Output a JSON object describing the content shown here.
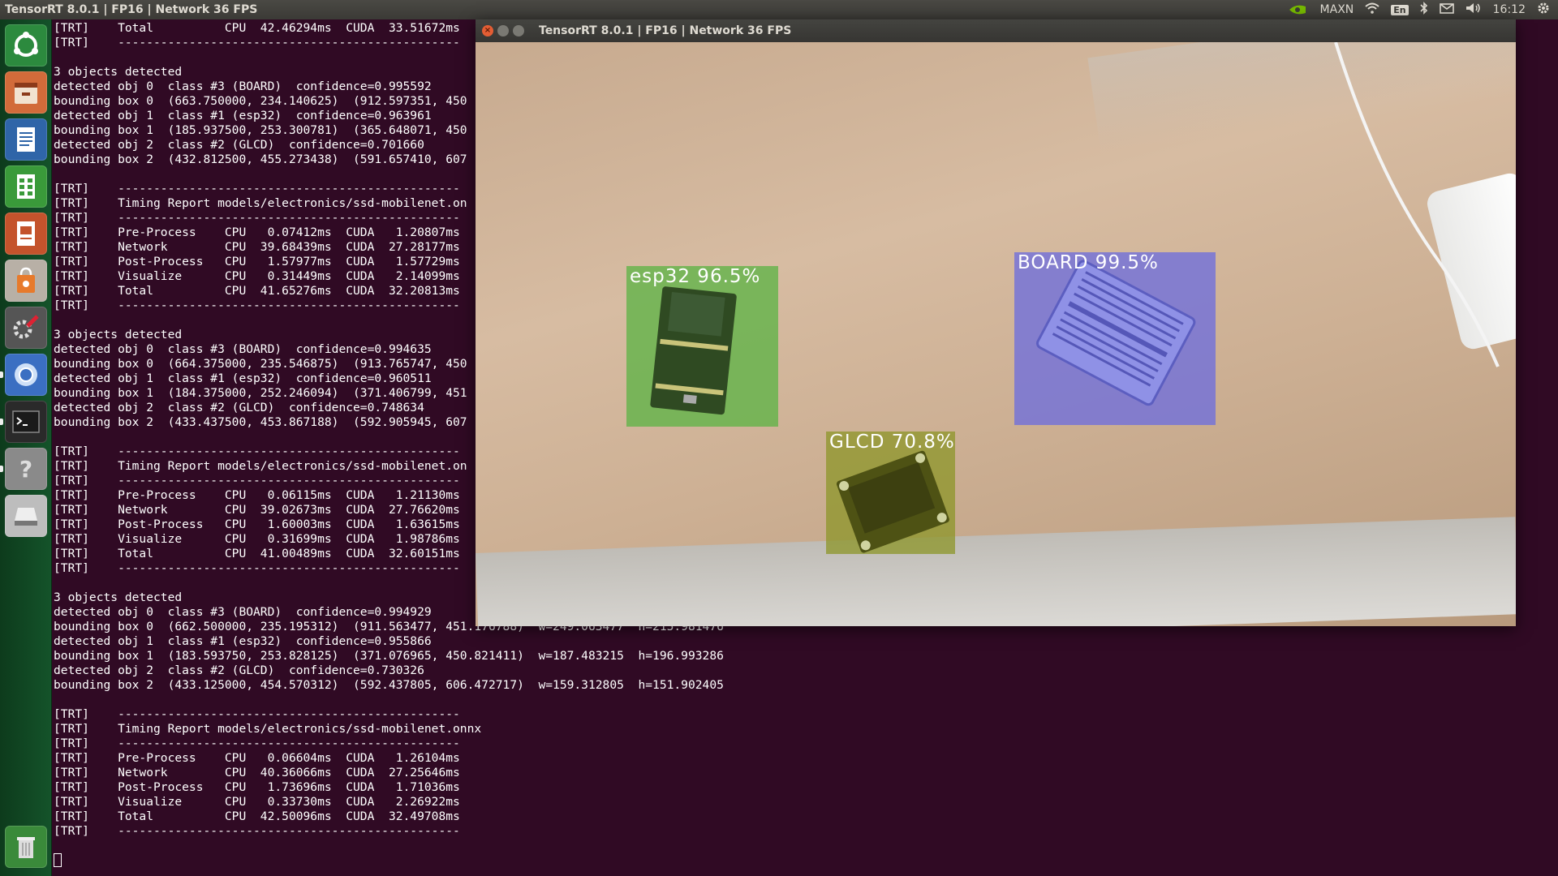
{
  "top_panel": {
    "title": "TensorRT 8.0.1 | FP16 | Network 36 FPS",
    "power_mode": "MAXN",
    "keyboard": "En",
    "clock": "16:12"
  },
  "launcher": {
    "items": [
      "ubuntu-logo-icon",
      "files-icon",
      "writer-icon",
      "calc-icon",
      "impress-icon",
      "software-center-icon",
      "settings-icon",
      "chromium-icon",
      "terminal-icon",
      "help-icon",
      "drive-icon",
      "trash-icon"
    ]
  },
  "terminal": {
    "lines": [
      "[TRT]    Total          CPU  42.46294ms  CUDA  33.51672ms",
      "[TRT]    ------------------------------------------------",
      "",
      "3 objects detected",
      "detected obj 0  class #3 (BOARD)  confidence=0.995592",
      "bounding box 0  (663.750000, 234.140625)  (912.597351, 450",
      "detected obj 1  class #1 (esp32)  confidence=0.963961",
      "bounding box 1  (185.937500, 253.300781)  (365.648071, 450",
      "detected obj 2  class #2 (GLCD)  confidence=0.701660",
      "bounding box 2  (432.812500, 455.273438)  (591.657410, 607",
      "",
      "[TRT]    ------------------------------------------------",
      "[TRT]    Timing Report models/electronics/ssd-mobilenet.on",
      "[TRT]    ------------------------------------------------",
      "[TRT]    Pre-Process    CPU   0.07412ms  CUDA   1.20807ms",
      "[TRT]    Network        CPU  39.68439ms  CUDA  27.28177ms",
      "[TRT]    Post-Process   CPU   1.57977ms  CUDA   1.57729ms",
      "[TRT]    Visualize      CPU   0.31449ms  CUDA   2.14099ms",
      "[TRT]    Total          CPU  41.65276ms  CUDA  32.20813ms",
      "[TRT]    ------------------------------------------------",
      "",
      "3 objects detected",
      "detected obj 0  class #3 (BOARD)  confidence=0.994635",
      "bounding box 0  (664.375000, 235.546875)  (913.765747, 450",
      "detected obj 1  class #1 (esp32)  confidence=0.960511",
      "bounding box 1  (184.375000, 252.246094)  (371.406799, 451",
      "detected obj 2  class #2 (GLCD)  confidence=0.748634",
      "bounding box 2  (433.437500, 453.867188)  (592.905945, 607",
      "",
      "[TRT]    ------------------------------------------------",
      "[TRT]    Timing Report models/electronics/ssd-mobilenet.on",
      "[TRT]    ------------------------------------------------",
      "[TRT]    Pre-Process    CPU   0.06115ms  CUDA   1.21130ms",
      "[TRT]    Network        CPU  39.02673ms  CUDA  27.76620ms",
      "[TRT]    Post-Process   CPU   1.60003ms  CUDA   1.63615ms",
      "[TRT]    Visualize      CPU   0.31699ms  CUDA   1.98786ms",
      "[TRT]    Total          CPU  41.00489ms  CUDA  32.60151ms",
      "[TRT]    ------------------------------------------------",
      "",
      "3 objects detected",
      "detected obj 0  class #3 (BOARD)  confidence=0.994929",
      "bounding box 0  (662.500000, 235.195312)  (911.563477, 451.176788)  w=249.063477  h=215.981476",
      "detected obj 1  class #1 (esp32)  confidence=0.955866",
      "bounding box 1  (183.593750, 253.828125)  (371.076965, 450.821411)  w=187.483215  h=196.993286",
      "detected obj 2  class #2 (GLCD)  confidence=0.730326",
      "bounding box 2  (433.125000, 454.570312)  (592.437805, 606.472717)  w=159.312805  h=151.902405",
      "",
      "[TRT]    ------------------------------------------------",
      "[TRT]    Timing Report models/electronics/ssd-mobilenet.onnx",
      "[TRT]    ------------------------------------------------",
      "[TRT]    Pre-Process    CPU   0.06604ms  CUDA   1.26104ms",
      "[TRT]    Network        CPU  40.36066ms  CUDA  27.25646ms",
      "[TRT]    Post-Process   CPU   1.73696ms  CUDA   1.71036ms",
      "[TRT]    Visualize      CPU   0.33730ms  CUDA   2.26922ms",
      "[TRT]    Total          CPU  42.50096ms  CUDA  32.49708ms",
      "[TRT]    ------------------------------------------------"
    ]
  },
  "camera_window": {
    "title": "TensorRT 8.0.1 | FP16 | Network 36 FPS",
    "detections": [
      {
        "label": "esp32 96.5%",
        "color": "#5fb446"
      },
      {
        "label": "BOARD 99.5%",
        "color": "#6e6edc"
      },
      {
        "label": "GLCD 70.8%",
        "color": "#8c9628"
      }
    ]
  }
}
